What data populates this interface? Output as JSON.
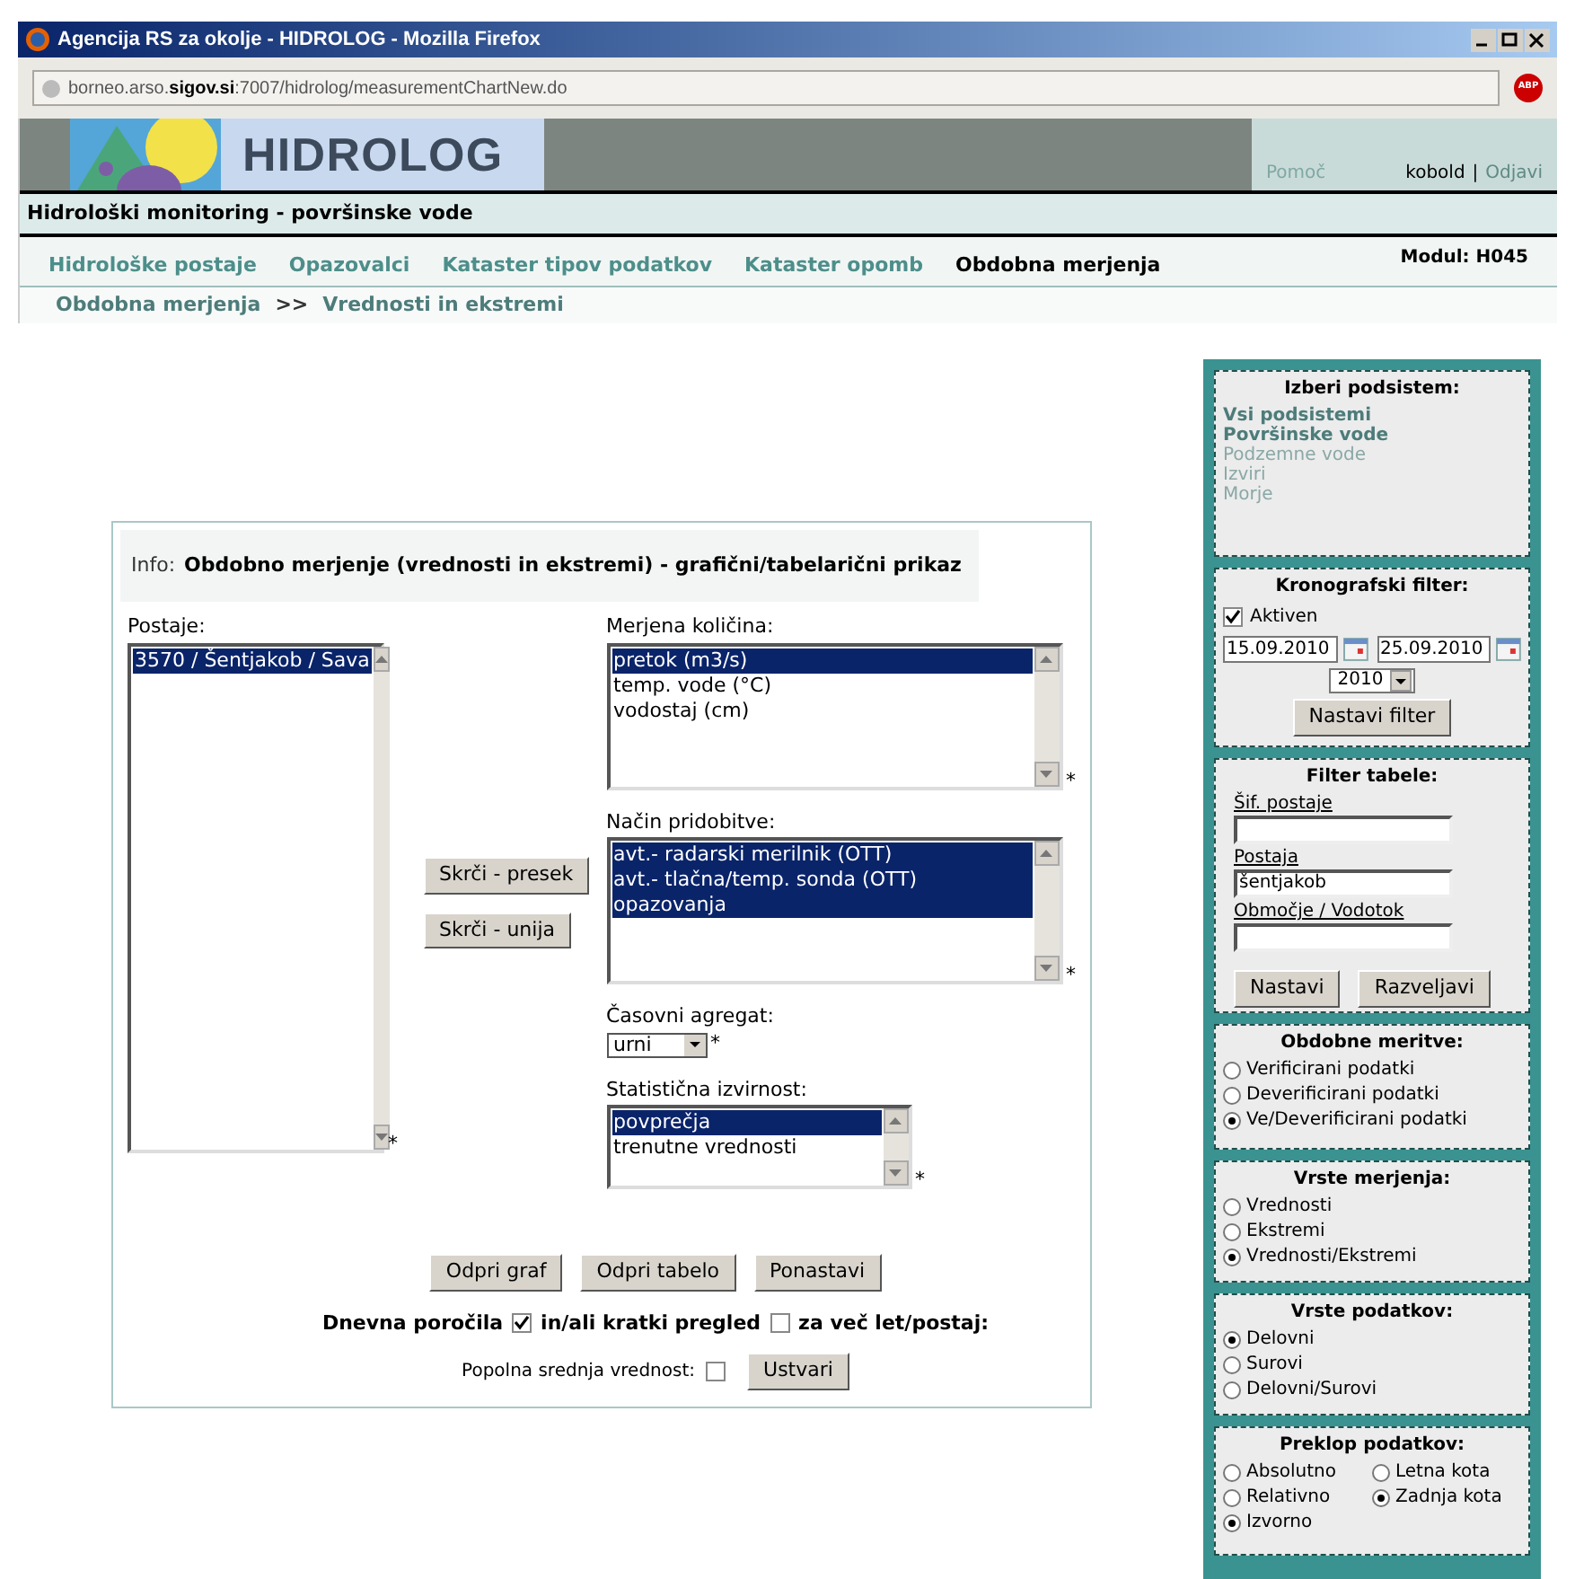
{
  "browser": {
    "title": "Agencija RS za okolje - HIDROLOG - Mozilla Firefox",
    "address": "borneo.arso.**sigov.si**:7007/hidrolog/measurementChartNew.do",
    "addon": "ABP"
  },
  "banner": {
    "logo_text": "HIDROLOG",
    "help": "Pomoč",
    "user": "kobold",
    "separator": "|",
    "logout": "Odjavi"
  },
  "subtitle": "Hidrološki monitoring - površinske vode",
  "nav": {
    "tabs": [
      {
        "label": "Hidrološke postaje",
        "selected": false
      },
      {
        "label": "Opazovalci",
        "selected": false
      },
      {
        "label": "Kataster tipov podatkov",
        "selected": false
      },
      {
        "label": "Kataster opomb",
        "selected": false
      },
      {
        "label": "Obdobna merjenja",
        "selected": true
      }
    ],
    "module": "Modul: H045"
  },
  "breadcrumb": {
    "parent": "Obdobna merjenja",
    "separator": ">>",
    "current": "Vrednosti in ekstremi"
  },
  "form": {
    "info_label": "Info:",
    "info_title": "Obdobno merjenje (vrednosti in ekstremi) - grafični/tabelarični prikaz",
    "stations": {
      "label": "Postaje:",
      "required": "*",
      "items": [
        {
          "text": "3570 / Šentjakob / Sava",
          "selected": true
        }
      ]
    },
    "middle_buttons": [
      "Skrči - presek",
      "Skrči - unija"
    ],
    "quantity": {
      "label": "Merjena količina:",
      "required": "*",
      "items": [
        {
          "text": "pretok (m3/s)",
          "selected": true
        },
        {
          "text": "temp. vode (°C)",
          "selected": false
        },
        {
          "text": "vodostaj (cm)",
          "selected": false
        }
      ]
    },
    "method": {
      "label": "Način pridobitve:",
      "required": "*",
      "items": [
        {
          "text": "avt.- radarski merilnik (OTT)",
          "selected": true
        },
        {
          "text": "avt.- tlačna/temp. sonda (OTT)",
          "selected": true
        },
        {
          "text": "opazovanja",
          "selected": true
        }
      ]
    },
    "aggregate": {
      "label": "Časovni agregat:",
      "value": "urni",
      "required": "*"
    },
    "statistic": {
      "label": "Statistična izvirnost:",
      "required": "*",
      "items": [
        {
          "text": "povprečja",
          "selected": true
        },
        {
          "text": "trenutne vrednosti",
          "selected": false
        }
      ]
    },
    "actions": [
      "Odpri graf",
      "Odpri tabelo",
      "Ponastavi"
    ],
    "daily": {
      "label": "Dnevna poročila",
      "checked": true,
      "middle": "in/ali kratki pregled",
      "checked_2": false,
      "end": "za več let/postaj:"
    },
    "average": {
      "label": "Popolna srednja vrednost:",
      "checked": false,
      "button": "Ustvari"
    }
  },
  "sidebar": [
    {
      "kind": "links",
      "title": "Izberi podsistem:",
      "items": [
        {
          "label": "Vsi podsistemi",
          "active": true
        },
        {
          "label": "Površinske vode",
          "active": true
        },
        {
          "label": "Podzemne vode",
          "active": false
        },
        {
          "label": "Izviri",
          "active": false
        },
        {
          "label": "Morje",
          "active": false
        }
      ]
    },
    {
      "kind": "chrono",
      "title": "Kronografski filter:",
      "checkbox_label": "Aktiven",
      "checked": true,
      "from": "15.09.2010",
      "to": "25.09.2010",
      "year": "2010",
      "button": "Nastavi filter"
    },
    {
      "kind": "filter",
      "title": "Filter tabele:",
      "fields": [
        {
          "label": "Šif. postaje"
        },
        {
          "label": "Postaja",
          "value": "šentjakob"
        },
        {
          "label": "Območje / Vodotok"
        }
      ],
      "buttons": [
        "Nastavi",
        "Razveljavi"
      ]
    },
    {
      "kind": "radios",
      "title": "Obdobne meritve:",
      "options": [
        {
          "label": "Verificirani podatki",
          "selected": false
        },
        {
          "label": "Deverificirani podatki",
          "selected": false
        },
        {
          "label": "Ve/Deverificirani podatki",
          "selected": true
        }
      ]
    },
    {
      "kind": "radios",
      "title": "Vrste merjenja:",
      "options": [
        {
          "label": "Vrednosti",
          "selected": false
        },
        {
          "label": "Ekstremi",
          "selected": false
        },
        {
          "label": "Vrednosti/Ekstremi",
          "selected": true
        }
      ]
    },
    {
      "kind": "radios",
      "title": "Vrste podatkov:",
      "options": [
        {
          "label": "Delovni",
          "selected": true
        },
        {
          "label": "Surovi",
          "selected": false
        },
        {
          "label": "Delovni/Surovi",
          "selected": false
        }
      ]
    },
    {
      "kind": "radio_grid",
      "title": "Preklop podatkov:",
      "options": [
        {
          "label": "Absolutno",
          "selected": false
        },
        {
          "label": "Letna kota",
          "selected": false
        },
        {
          "label": "Relativno",
          "selected": false
        },
        {
          "label": "Zadnja kota",
          "selected": true
        },
        {
          "label": "Izvorno",
          "selected": true
        }
      ]
    }
  ]
}
